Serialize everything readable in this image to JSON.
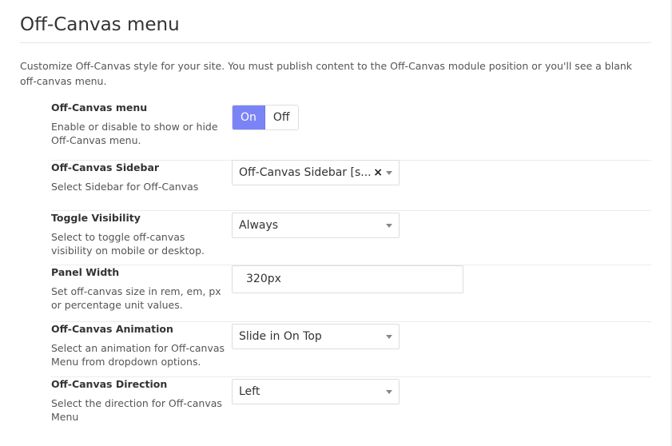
{
  "page": {
    "title": "Off-Canvas menu",
    "description": "Customize Off-Canvas style for your site. You must publish content to the Off-Canvas module position or you'll see a blank off-canvas menu."
  },
  "fields": {
    "offcanvas_menu": {
      "label": "Off-Canvas menu",
      "help": "Enable or disable to show or hide Off-Canvas menu.",
      "on_label": "On",
      "off_label": "Off",
      "selected": "On"
    },
    "offcanvas_sidebar": {
      "label": "Off-Canvas Sidebar",
      "help": "Select Sidebar for Off-Canvas",
      "value": "Off-Canvas Sidebar [s...",
      "clear_icon": "×"
    },
    "toggle_visibility": {
      "label": "Toggle Visibility",
      "help": "Select to toggle off-canvas visibility on mobile or desktop.",
      "value": "Always"
    },
    "panel_width": {
      "label": "Panel Width",
      "help": "Set off-canvas size in rem, em, px or percentage unit values.",
      "value": "320px"
    },
    "offcanvas_animation": {
      "label": "Off-Canvas Animation",
      "help": "Select an animation for Off-canvas Menu from dropdown options.",
      "value": "Slide in On Top"
    },
    "offcanvas_direction": {
      "label": "Off-Canvas Direction",
      "help": "Select the direction for Off-canvas Menu",
      "value": "Left"
    }
  },
  "colors": {
    "toggle_active": "#7b84f7"
  },
  "icons": {
    "select_caret": "chevron-down-icon",
    "clear": "close-icon"
  }
}
